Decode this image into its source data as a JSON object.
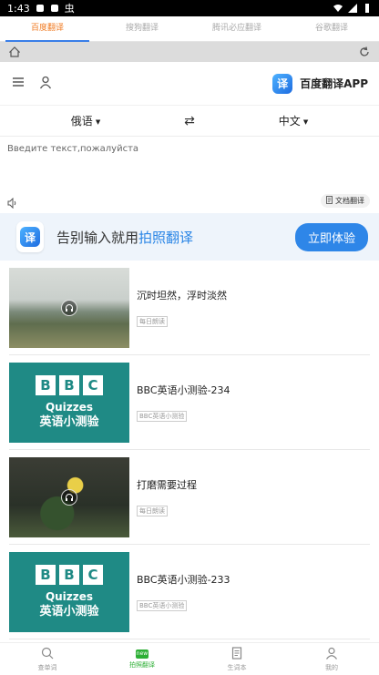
{
  "status": {
    "time": "1:43",
    "notif_glyph": "虫"
  },
  "tabs": [
    {
      "label": "百度翻译",
      "active": true
    },
    {
      "label": "搜狗翻译",
      "active": false
    },
    {
      "label": "腾讯必应翻译",
      "active": false
    },
    {
      "label": "谷歌翻译",
      "active": false
    }
  ],
  "header": {
    "app_name": "百度翻译APP",
    "logo_char": "译"
  },
  "translate": {
    "source_lang": "俄语",
    "target_lang": "中文",
    "swap_glyph": "⇄",
    "placeholder": "Введите текст,пожалуйста",
    "doc_button": "文档翻译"
  },
  "promo": {
    "text_prefix": "告别输入就用",
    "text_highlight": "拍照翻译",
    "button": "立即体验",
    "logo_char": "译"
  },
  "feed": [
    {
      "title": "沉时坦然，浮时淡然",
      "tag": "每日朗读",
      "image": "landscape",
      "audio": true
    },
    {
      "title": "BBC英语小测验-234",
      "tag": "BBC英语小测验",
      "image": "bbc",
      "audio": false
    },
    {
      "title": "打磨需要过程",
      "tag": "每日朗读",
      "image": "flower",
      "audio": true
    },
    {
      "title": "BBC英语小测验-233",
      "tag": "BBC英语小测验",
      "image": "bbc",
      "audio": false
    }
  ],
  "bbc_thumb": {
    "letters": [
      "B",
      "B",
      "C"
    ],
    "quizzes": "Quizzes",
    "cn": "英语小测验"
  },
  "bottom_nav": [
    {
      "label": "查单词",
      "icon": "search-icon",
      "active": false
    },
    {
      "label": "拍照翻译",
      "icon": "camera-icon",
      "active": true,
      "badge": "new"
    },
    {
      "label": "生词本",
      "icon": "notebook-icon",
      "active": false
    },
    {
      "label": "我的",
      "icon": "user-icon",
      "active": false
    }
  ]
}
